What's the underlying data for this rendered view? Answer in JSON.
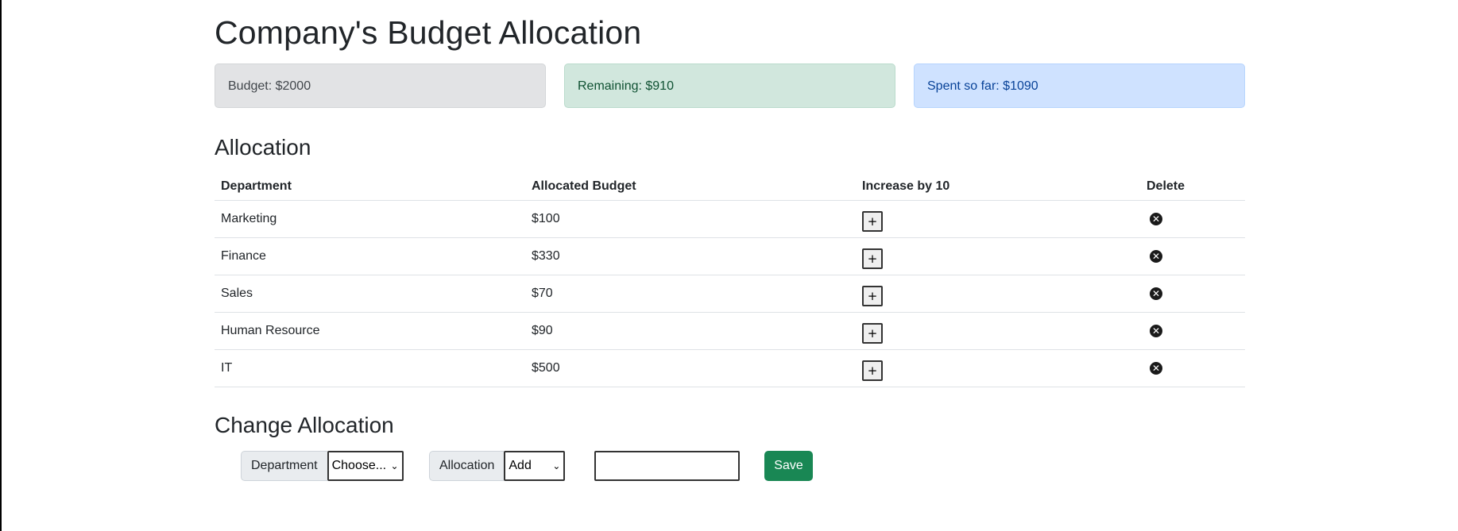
{
  "page": {
    "title": "Company's Budget Allocation"
  },
  "summary": {
    "budget": "Budget: $2000",
    "remaining": "Remaining: $910",
    "spent": "Spent so far: $1090"
  },
  "allocation": {
    "title": "Allocation",
    "headers": {
      "department": "Department",
      "allocated_budget": "Allocated Budget",
      "increase": "Increase by 10",
      "delete": "Delete"
    },
    "rows": [
      {
        "department": "Marketing",
        "budget": "$100",
        "increase_label": "+",
        "delete_icon": "x-circle-icon"
      },
      {
        "department": "Finance",
        "budget": "$330",
        "increase_label": "+",
        "delete_icon": "x-circle-icon"
      },
      {
        "department": "Sales",
        "budget": "$70",
        "increase_label": "+",
        "delete_icon": "x-circle-icon"
      },
      {
        "department": "Human Resource",
        "budget": "$90",
        "increase_label": "+",
        "delete_icon": "x-circle-icon"
      },
      {
        "department": "IT",
        "budget": "$500",
        "increase_label": "+",
        "delete_icon": "x-circle-icon"
      }
    ]
  },
  "change_allocation": {
    "title": "Change Allocation",
    "department_label": "Department",
    "department_selected": "Choose...",
    "allocation_label": "Allocation",
    "allocation_selected": "Add",
    "amount_value": "",
    "save_label": "Save"
  },
  "colors": {
    "save_button": "#198754",
    "budget_alert": "#e2e3e5",
    "remaining_alert": "#d1e7dd",
    "spent_alert": "#cfe2ff"
  }
}
